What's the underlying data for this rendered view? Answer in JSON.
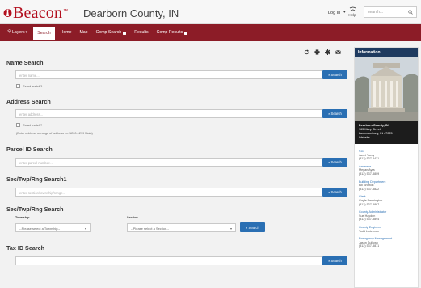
{
  "header": {
    "logo": "Beacon",
    "logo_tm": "™",
    "county": "Dearborn County, IN",
    "login": "Log In",
    "help_label": "Help",
    "search_placeholder": "search..."
  },
  "nav": {
    "items": [
      {
        "label": "Layers",
        "has_caret": true
      },
      {
        "label": "Search",
        "active": true
      },
      {
        "label": "Home"
      },
      {
        "label": "Map"
      },
      {
        "label": "Comp Search",
        "locked": true
      },
      {
        "label": "Results"
      },
      {
        "label": "Comp Results",
        "locked": true
      }
    ]
  },
  "sections": {
    "name": {
      "title": "Name Search",
      "placeholder": "enter name...",
      "exact": "Exact match?",
      "button": "Search"
    },
    "address": {
      "title": "Address Search",
      "placeholder": "enter address...",
      "exact": "Exact match?",
      "hint": "(Enter address or range of address ex: 1200-1299 Main)",
      "button": "Search"
    },
    "parcel": {
      "title": "Parcel ID Search",
      "placeholder": "enter parcel number...",
      "button": "Search"
    },
    "str1": {
      "title": "Sec/Twp/Rng Search1",
      "placeholder": "enter section/township/range...",
      "button": "Search"
    },
    "str2": {
      "title": "Sec/Twp/Rng Search",
      "township_label": "Township",
      "township_value": "--Please select a Township--",
      "section_label": "Section",
      "section_value": "--Please select a Section--",
      "button": "Search"
    },
    "tax": {
      "title": "Tax ID Search",
      "placeholder": "",
      "button": "Search"
    }
  },
  "info": {
    "title": "Information",
    "office_name": "Dearborn County, IN",
    "address1": "165 Mary Street",
    "address2": "Lawrenceburg, IN 47025",
    "website": "Website",
    "contacts": [
      {
        "title": "911",
        "name": "Janet Tuery",
        "phone": "(812) 537-3431"
      },
      {
        "title": "Assessor",
        "name": "Megan Ayra",
        "phone": "(812) 537-8809"
      },
      {
        "title": "Building Department",
        "name": "Bill Shelton",
        "phone": "(812) 537-8822"
      },
      {
        "title": "Clerk",
        "name": "Gayle Pennington",
        "phone": "(812) 537-8867"
      },
      {
        "title": "County Administrator",
        "name": "Sue Hayden",
        "phone": "(812) 537-8894"
      },
      {
        "title": "County Engineer",
        "name": "Todd Listerman",
        "phone": ""
      },
      {
        "title": "Emergency Management",
        "name": "Jason Sullivan",
        "phone": "(812) 537-8871"
      }
    ]
  },
  "colors": {
    "brand": "#b30f1e",
    "nav": "#8c1c27",
    "button": "#2a6fb3",
    "panel_head": "#1e3a5f"
  }
}
